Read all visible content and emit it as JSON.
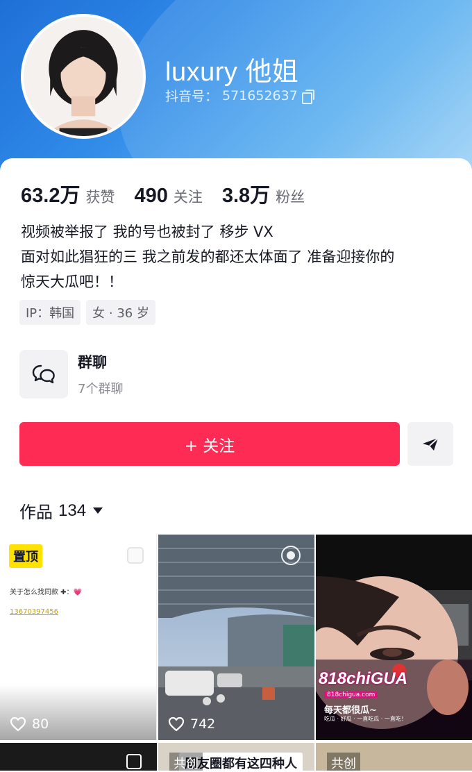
{
  "profile": {
    "nickname": "luxury 他姐",
    "douyin_id_label": "抖音号：",
    "douyin_id": "571652637"
  },
  "stats": [
    {
      "value": "63.2万",
      "label": "获赞"
    },
    {
      "value": "490",
      "label": "关注"
    },
    {
      "value": "3.8万",
      "label": "粉丝"
    }
  ],
  "bio": {
    "lines": [
      "视频被举报了 我的号也被封了  移步 VX",
      "面对如此猖狂的三 我之前发的都还太体面了 准备迎接你的",
      "惊天大瓜吧！！"
    ]
  },
  "tags": {
    "ip": "IP：韩国",
    "gender_age": "女 · 36 岁"
  },
  "group_chat": {
    "title": "群聊",
    "subtitle": "7个群聊"
  },
  "actions": {
    "follow_label": "+ 关注"
  },
  "works": {
    "label": "作品",
    "count": "134"
  },
  "grid": {
    "tiles": [
      {
        "badge": "置顶",
        "note_line": "关于怎么找同款 ✚：💗",
        "note_number": "13670397456",
        "likes": "80"
      },
      {
        "likes": "742"
      },
      {
        "wm_logo": "818chiGUA",
        "wm_url": "818chigua.com",
        "wm_line": "每天都很瓜~",
        "wm_sub": "吃瓜 · 好瓜 · 一直吃瓜 · 一直吃！"
      },
      {},
      {
        "label": "共创",
        "caption": "朋友圈都有这四种人"
      },
      {
        "label": "共创"
      }
    ]
  },
  "colors": {
    "accent": "#fe2c55",
    "banner_start": "#1f6fd6",
    "banner_end": "#9fd2f6",
    "pin_badge": "#ffe200"
  },
  "icons": [
    "copy-icon",
    "group-chat-icon",
    "share-icon",
    "dropdown-triangle-icon",
    "heart-icon",
    "live-photo-icon"
  ]
}
